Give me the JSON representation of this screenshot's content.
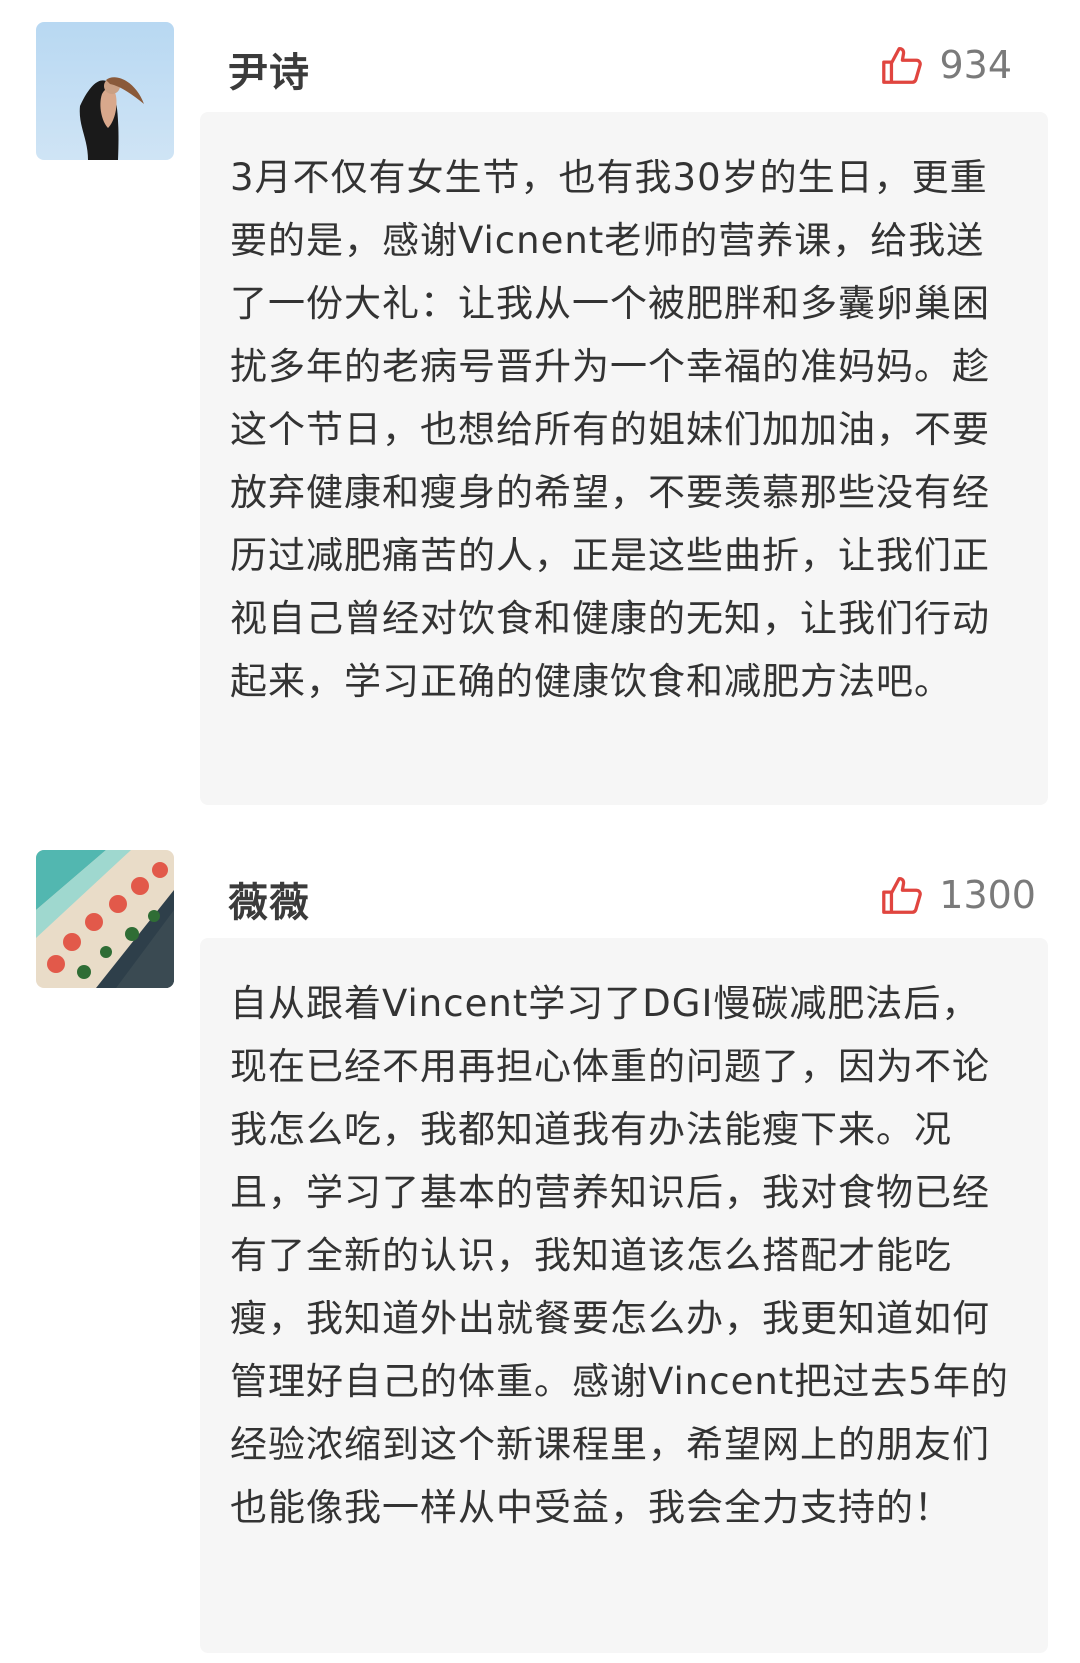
{
  "comments": [
    {
      "username": "尹诗",
      "likes": "934",
      "text": "3月不仅有女生节，也有我30岁的生日，更重要的是，感谢Vicnent老师的营养课，给我送了一份大礼：让我从一个被肥胖和多囊卵巢困扰多年的老病号晋升为一个幸福的准妈妈。趁这个节日，也想给所有的姐妹们加加油，不要放弃健康和瘦身的希望，不要羡慕那些没有经历过减肥痛苦的人，正是这些曲折，让我们正视自己曾经对饮食和健康的无知，让我们行动起来，学习正确的健康饮食和减肥方法吧。"
    },
    {
      "username": "薇薇",
      "likes": "1300",
      "text": "自从跟着Vincent学习了DGI慢碳减肥法后，现在已经不用再担心体重的问题了，因为不论我怎么吃，我都知道我有办法能瘦下来。况且，学习了基本的营养知识后，我对食物已经有了全新的认识，我知道该怎么搭配才能吃瘦，我知道外出就餐要怎么办，我更知道如何管理好自己的体重。感谢Vincent把过去5年的经验浓缩到这个新课程里，希望网上的朋友们也能像我一样从中受益，我会全力支持的！"
    }
  ],
  "colors": {
    "like_icon": "#e0453f",
    "bubble_bg": "#f6f6f6",
    "username": "#3b3b3b",
    "like_count": "#7a7a7a"
  },
  "icons": {
    "like": "thumbs-up-icon"
  }
}
